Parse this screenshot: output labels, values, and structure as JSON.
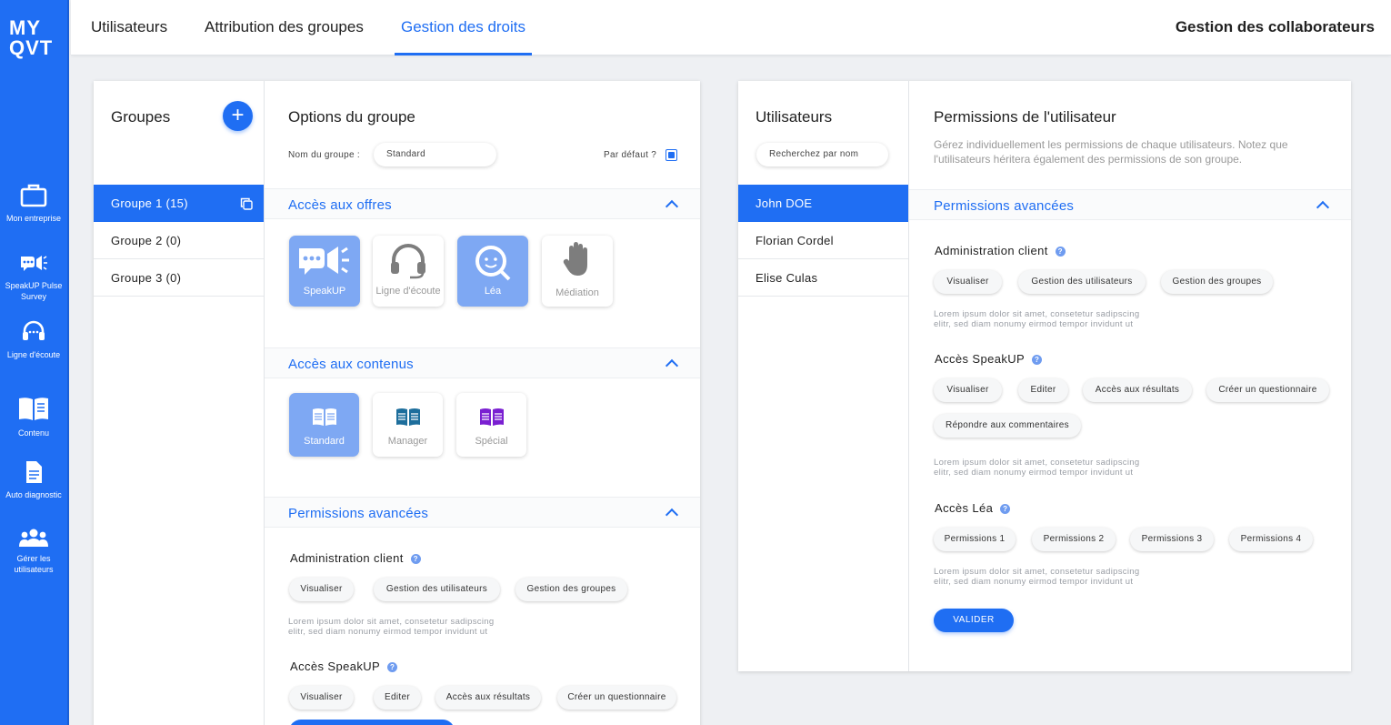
{
  "brand": {
    "logo_line1": "MY",
    "logo_line2": "QVT",
    "accent": "#1f6ef3"
  },
  "sidebar": {
    "items": [
      {
        "icon": "briefcase-icon",
        "label": "Mon entreprise"
      },
      {
        "icon": "megaphone-icon",
        "label": "SpeakUP Pulse Survey"
      },
      {
        "icon": "headset-icon",
        "label": "Ligne d'écoute"
      },
      {
        "icon": "book-icon",
        "label": "Contenu"
      },
      {
        "icon": "document-icon",
        "label": "Auto diagnostic"
      },
      {
        "icon": "users-icon",
        "label": "Gérer les utilisateurs"
      }
    ]
  },
  "header": {
    "tabs": [
      {
        "label": "Utilisateurs"
      },
      {
        "label": "Attribution des groupes"
      },
      {
        "label": "Gestion des droits"
      }
    ],
    "active_tab": "Gestion des droits",
    "right_title": "Gestion des collaborateurs"
  },
  "groups": {
    "title": "Groupes",
    "add_symbol": "+",
    "items": [
      {
        "label": "Groupe 1 (15)"
      },
      {
        "label": "Groupe 2 (0)"
      },
      {
        "label": "Groupe 3 (0)"
      }
    ]
  },
  "group_options": {
    "title": "Options du groupe",
    "name_label": "Nom du groupe :",
    "name_value": "Standard",
    "default_label": "Par défaut ?",
    "default_checked": true,
    "offers": {
      "title": "Accès aux offres",
      "tiles": [
        {
          "label": "SpeakUP",
          "icon": "megaphone-icon",
          "on": true
        },
        {
          "label": "Ligne d'écoute",
          "icon": "headset-icon",
          "on": false
        },
        {
          "label": "Léa",
          "icon": "lea-icon",
          "on": true
        },
        {
          "label": "Médiation",
          "icon": "hand-icon",
          "on": false
        }
      ]
    },
    "contents": {
      "title": "Accès aux contenus",
      "tiles": [
        {
          "label": "Standard",
          "icon": "book-icon",
          "on": true
        },
        {
          "label": "Manager",
          "icon": "book-icon",
          "on": false
        },
        {
          "label": "Spécial",
          "icon": "book-icon",
          "on": false
        }
      ]
    },
    "advanced": {
      "title": "Permissions avancées",
      "admin": {
        "title": "Administration client",
        "help": "?",
        "chips": [
          "Visualiser",
          "Gestion des utilisateurs",
          "Gestion des groupes"
        ],
        "desc_line1": "Lorem ipsum dolor sit amet, consetetur sadipscing",
        "desc_line2": "elitr, sed diam nonumy eirmod tempor invidunt ut"
      },
      "speakup": {
        "title": "Accès SpeakUP",
        "help": "?",
        "chips": [
          "Visualiser",
          "Editer",
          "Accès aux résultats",
          "Créer un questionnaire"
        ]
      }
    }
  },
  "users": {
    "title": "Utilisateurs",
    "search_placeholder": "Recherchez par nom",
    "items": [
      {
        "label": "John DOE"
      },
      {
        "label": "Florian Cordel"
      },
      {
        "label": "Elise Culas"
      }
    ]
  },
  "user_permissions": {
    "title": "Permissions de l'utilisateur",
    "intro_line1": "Gérez individuellement les permissions de chaque utilisateurs. Notez que",
    "intro_line2": "l'utilisateurs héritera également des permissions de son groupe.",
    "advanced_title": "Permissions avancées",
    "admin": {
      "title": "Administration client",
      "help": "?",
      "chips": [
        "Visualiser",
        "Gestion des utilisateurs",
        "Gestion des groupes"
      ],
      "desc_line1": "Lorem ipsum dolor sit amet, consetetur sadipscing",
      "desc_line2": "elitr, sed diam nonumy eirmod tempor invidunt ut"
    },
    "speakup": {
      "title": "Accès SpeakUP",
      "help": "?",
      "chips": [
        "Visualiser",
        "Editer",
        "Accès aux résultats",
        "Créer un questionnaire",
        "Répondre aux commentaires"
      ],
      "desc_line1": "Lorem ipsum dolor sit amet, consetetur sadipscing",
      "desc_line2": "elitr, sed diam nonumy eirmod tempor invidunt ut"
    },
    "lea": {
      "title": "Accès Léa",
      "help": "?",
      "chips": [
        "Permissions 1",
        "Permissions 2",
        "Permissions 3",
        "Permissions 4"
      ],
      "desc_line1": "Lorem ipsum dolor sit amet, consetetur sadipscing",
      "desc_line2": "elitr, sed diam nonumy eirmod tempor invidunt ut"
    },
    "submit_label": "VALIDER"
  }
}
